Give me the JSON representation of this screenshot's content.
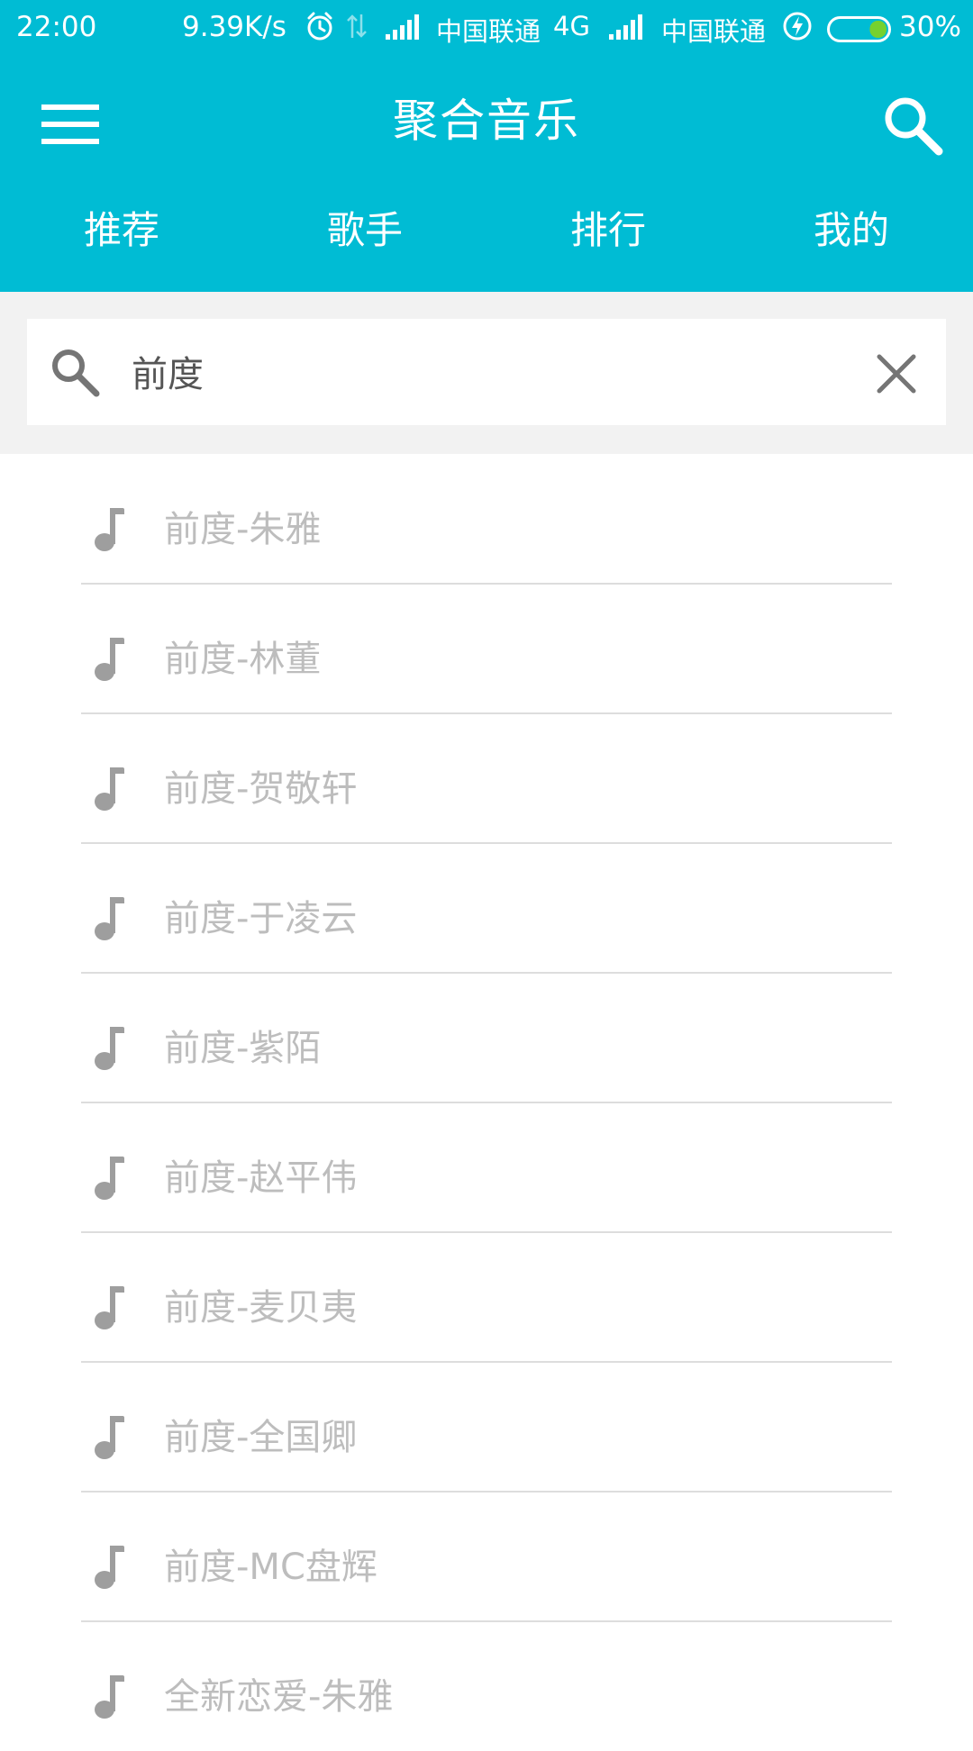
{
  "status_bar": {
    "time": "22:00",
    "speed": "9.39K/s",
    "carrier1": "中国联通",
    "network": "4G",
    "carrier2": "中国联通",
    "battery_percent": "30%",
    "battery_level": 0.3,
    "icons": [
      "alarm-icon",
      "data-transfer-icon",
      "signal-icon",
      "signal-icon",
      "charging-icon",
      "battery-icon"
    ]
  },
  "app_bar": {
    "title": "聚合音乐",
    "menu_icon": "menu-icon",
    "search_icon": "search-icon"
  },
  "tabs": [
    {
      "label": "推荐"
    },
    {
      "label": "歌手"
    },
    {
      "label": "排行"
    },
    {
      "label": "我的"
    }
  ],
  "search": {
    "value": "前度",
    "search_icon": "search-icon",
    "clear_icon": "close-icon"
  },
  "results": [
    {
      "label": "前度-朱雅"
    },
    {
      "label": "前度-林董"
    },
    {
      "label": "前度-贺敬轩"
    },
    {
      "label": "前度-于凌云"
    },
    {
      "label": "前度-紫陌"
    },
    {
      "label": "前度-赵平伟"
    },
    {
      "label": "前度-麦贝夷"
    },
    {
      "label": "前度-全国卿"
    },
    {
      "label": "前度-MC盘辉"
    },
    {
      "label": "全新恋爱-朱雅"
    }
  ],
  "colors": {
    "primary": "#00BCD4",
    "search_bg": "#F2F2F2",
    "item_text": "#BDBDBD",
    "icon_gray": "#9E9E9E",
    "divider": "#DDDDDD"
  }
}
